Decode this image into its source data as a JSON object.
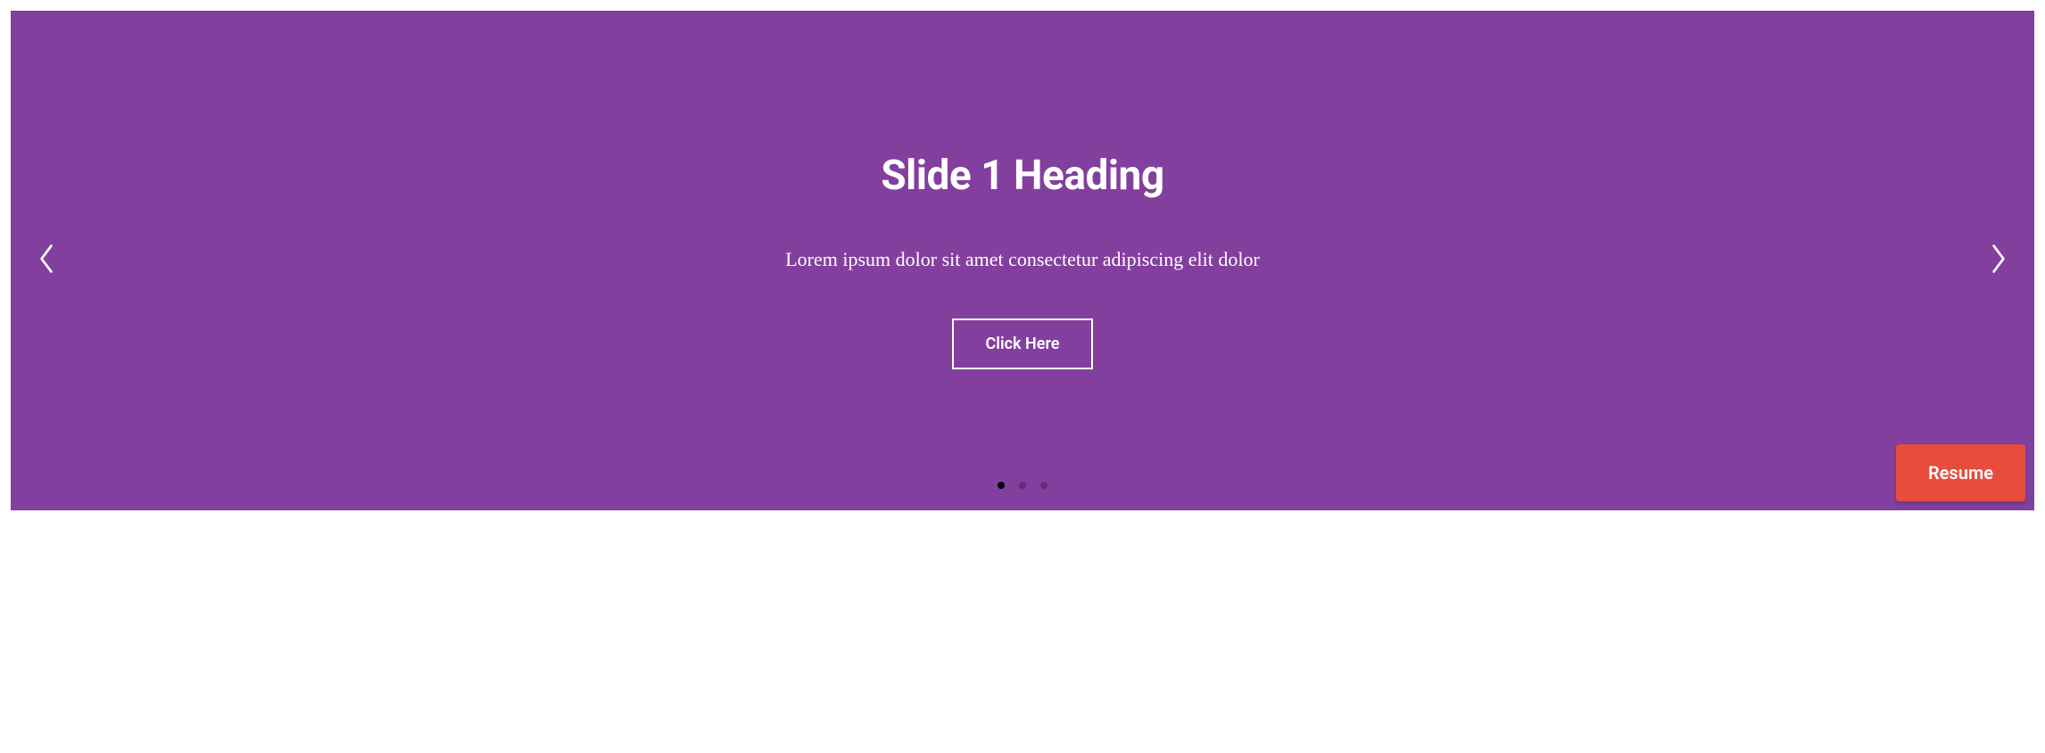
{
  "slide": {
    "heading": "Slide 1 Heading",
    "description": "Lorem ipsum dolor sit amet consectetur adipiscing elit dolor",
    "button_label": "Click Here"
  },
  "pagination": {
    "total": 3,
    "active_index": 0
  },
  "floating_button": {
    "label": "Resume"
  }
}
